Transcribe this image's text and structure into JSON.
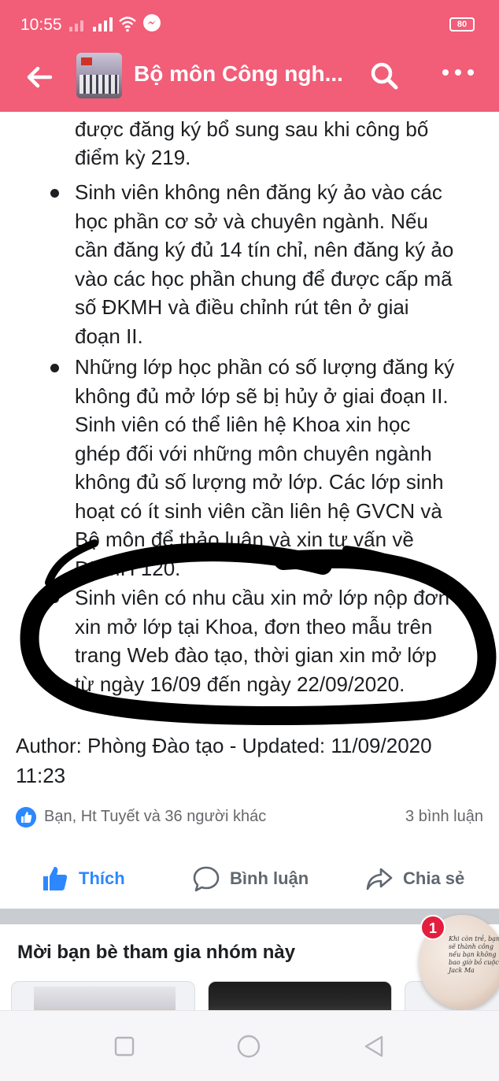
{
  "status_bar": {
    "time": "10:55",
    "battery": "80"
  },
  "nav": {
    "group_title": "Bộ môn Công ngh...",
    "back_icon": "arrow-left-icon",
    "search_icon": "search-icon",
    "more_icon": "more-horizontal-icon"
  },
  "post": {
    "intro_lines": [
      "được đăng ký bổ sung sau khi công bố",
      "điểm kỳ 219."
    ],
    "bullets": [
      {
        "lines": [
          "Sinh viên không nên đăng ký ảo vào các",
          "học phần cơ sở và chuyên ngành. Nếu",
          "cần đăng ký đủ 14 tín chỉ, nên đăng ký ảo",
          "vào các học phần chung để được cấp mã",
          "số ĐKMH và điều chỉnh rút tên ở giai",
          "đoạn II."
        ]
      },
      {
        "lines": [
          "Những lớp học phần có số lượng đăng ký",
          "không đủ mở lớp sẽ bị hủy ở giai đoạn II.",
          "Sinh viên có thể liên hệ Khoa xin học",
          "ghép đối với những môn chuyên ngành",
          "không đủ số lượng mở lớp. Các lớp sinh",
          "hoạt có ít sinh viên cần liên hệ GVCN và",
          "Bộ môn để thảo luận và xin tư vấn về",
          "ĐKMH 120."
        ]
      },
      {
        "lines": [
          "Sinh viên có nhu cầu xin mở lớp nộp đơn",
          "xin mở lớp tại Khoa, đơn theo mẫu trên",
          "trang Web đào tạo, thời gian xin mở lớp",
          "từ ngày 16/09 đến ngày 22/09/2020."
        ]
      }
    ],
    "author_line_1": "Author: Phòng Đào tạo - Updated: 11/09/2020",
    "author_line_2": "11:23"
  },
  "reactions": {
    "summary": "Bạn, Ht Tuyết và 36 người khác",
    "comments": "3 bình luận"
  },
  "actions": {
    "like": "Thích",
    "comment": "Bình luận",
    "share": "Chia sẻ"
  },
  "invite": {
    "title": "Mời bạn bè tham gia nhóm này"
  },
  "chat_head": {
    "badge": "1",
    "note_text": "Khi còn trẻ, bạn sẽ thành công nếu bạn không bao giờ bỏ cuộc - Jack Ma"
  },
  "colors": {
    "header_bg": "#f25d78",
    "facebook_blue": "#2d88ff",
    "badge_red": "#e41e3f"
  }
}
